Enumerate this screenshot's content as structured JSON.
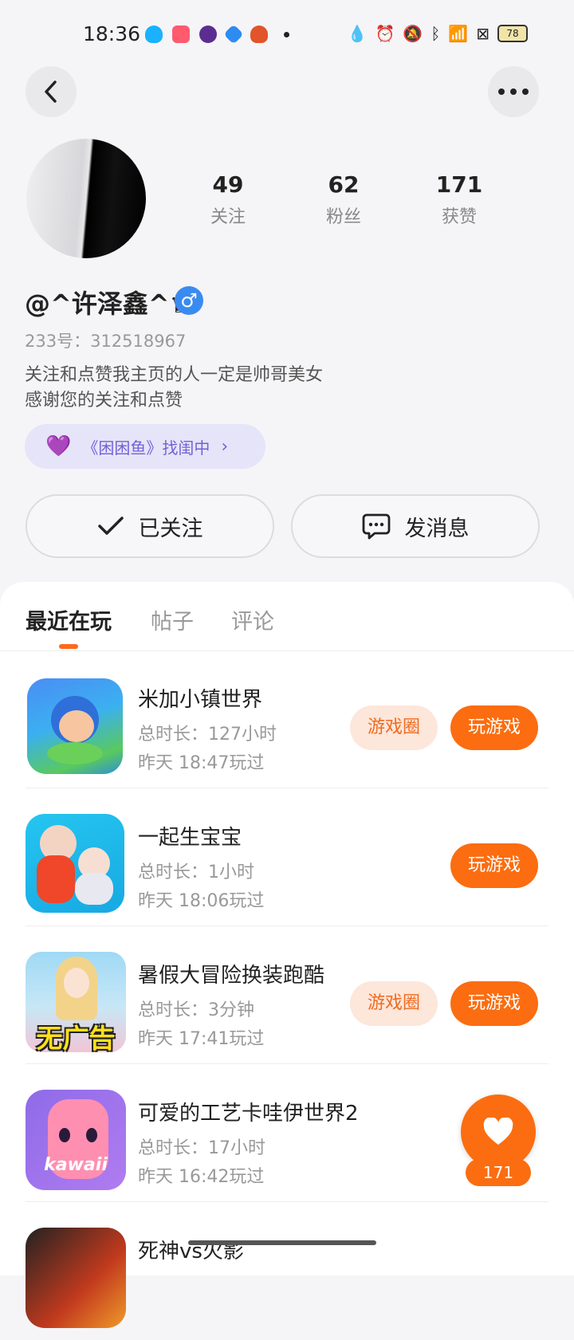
{
  "status_bar": {
    "time": "18:36",
    "battery": "78",
    "left_icons": [
      "qq-icon",
      "app-icon",
      "app-icon",
      "app-icon",
      "app-icon"
    ],
    "right_icons": [
      "drop-icon",
      "alarm-icon",
      "mute-icon",
      "bluetooth-icon",
      "wifi-icon",
      "sim-icon"
    ]
  },
  "profile": {
    "stats": [
      {
        "value": "49",
        "label": "关注"
      },
      {
        "value": "62",
        "label": "粉丝"
      },
      {
        "value": "171",
        "label": "获赞"
      }
    ],
    "nickname": "@^许泽鑫^♛",
    "gender_symbol": "♂",
    "id_text": "233号：312518967",
    "bio_line1": "关注和点赞我主页的人一定是帅哥美女",
    "bio_line2": "感谢您的关注和点赞",
    "seek_text": "《困困鱼》找闺中"
  },
  "actions": {
    "follow_label": "已关注",
    "message_label": "发消息"
  },
  "tabs": [
    {
      "label": "最近在玩",
      "active": true
    },
    {
      "label": "帖子",
      "active": false
    },
    {
      "label": "评论",
      "active": false
    }
  ],
  "games": [
    {
      "name": "米加小镇世界",
      "duration": "总时长：127小时",
      "last_played": "昨天 18:47玩过",
      "circle_label": "游戏圈",
      "play_label": "玩游戏"
    },
    {
      "name": "一起生宝宝",
      "duration": "总时长：1小时",
      "last_played": "昨天 18:06玩过",
      "play_label": "玩游戏"
    },
    {
      "name": "暑假大冒险换装跑酷",
      "duration": "总时长：3分钟",
      "last_played": "昨天 17:41玩过",
      "circle_label": "游戏圈",
      "play_label": "玩游戏",
      "icon_text": "无广告"
    },
    {
      "name": "可爱的工艺卡哇伊世界2",
      "duration": "总时长：17小时",
      "last_played": "昨天 16:42玩过",
      "icon_text": "kawaii"
    },
    {
      "name": "死神vs火影"
    }
  ],
  "like_fab": {
    "count": "171"
  },
  "colors": {
    "accent": "#fb6d10",
    "accent_light": "#fde6da",
    "purple": "#7360d6",
    "male_blue": "#3a8bf0"
  }
}
